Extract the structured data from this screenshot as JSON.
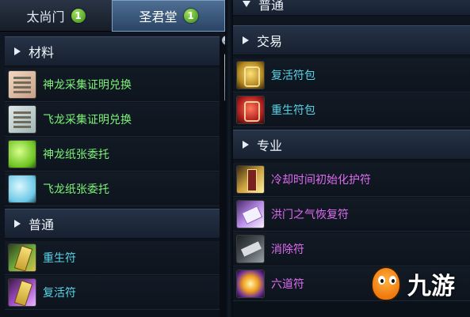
{
  "left_panel": {
    "tabs": [
      {
        "label": "太尚门",
        "badge": "1"
      },
      {
        "label": "圣君堂",
        "badge": "1"
      }
    ],
    "sections": [
      {
        "title": "材料",
        "items": [
          {
            "label": "神龙采集证明兑换",
            "icon": "paper-scroll-red-icon",
            "color": "#7ef37a"
          },
          {
            "label": "飞龙采集证明兑换",
            "icon": "paper-scroll-gray-icon",
            "color": "#7ef37a"
          },
          {
            "label": "神龙纸张委托",
            "icon": "green-paper-icon",
            "color": "#7ef37a"
          },
          {
            "label": "飞龙纸张委托",
            "icon": "blue-paper-icon",
            "color": "#7ef37a"
          }
        ]
      },
      {
        "title": "普通",
        "items": [
          {
            "label": "重生符",
            "icon": "green-talisman-icon",
            "color": "#58d4e8"
          },
          {
            "label": "复活符",
            "icon": "purple-talisman-icon",
            "color": "#58d4e8"
          }
        ]
      }
    ]
  },
  "right_panel": {
    "top_section": {
      "title": "普通"
    },
    "sections": [
      {
        "title": "交易",
        "items": [
          {
            "label": "复活符包",
            "icon": "gold-pack-icon",
            "color": "#58d4e8"
          },
          {
            "label": "重生符包",
            "icon": "red-pack-icon",
            "color": "#58d4e8"
          }
        ]
      },
      {
        "title": "专业",
        "items": [
          {
            "label": "冷却时间初始化护符",
            "icon": "gold-amulet-icon",
            "color": "#e06cf4"
          },
          {
            "label": "洪门之气恢复符",
            "icon": "purple-card-icon",
            "color": "#e06cf4"
          },
          {
            "label": "消除符",
            "icon": "gray-slab-icon",
            "color": "#e06cf4"
          },
          {
            "label": "六道符",
            "icon": "burst-charm-icon",
            "color": "#e06cf4"
          }
        ]
      }
    ]
  },
  "watermark": {
    "text": "九游"
  }
}
